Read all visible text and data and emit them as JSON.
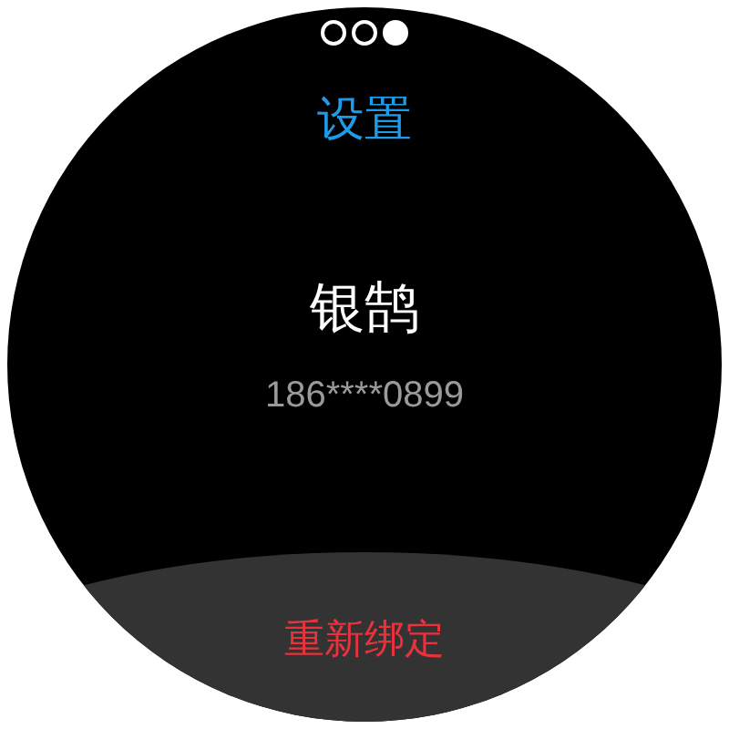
{
  "page_dots": [
    {
      "selected": false
    },
    {
      "selected": false
    },
    {
      "selected": true
    }
  ],
  "title": "设置",
  "device_name": "银鹄",
  "phone": "186****0899",
  "rebind_button": "重新绑定"
}
